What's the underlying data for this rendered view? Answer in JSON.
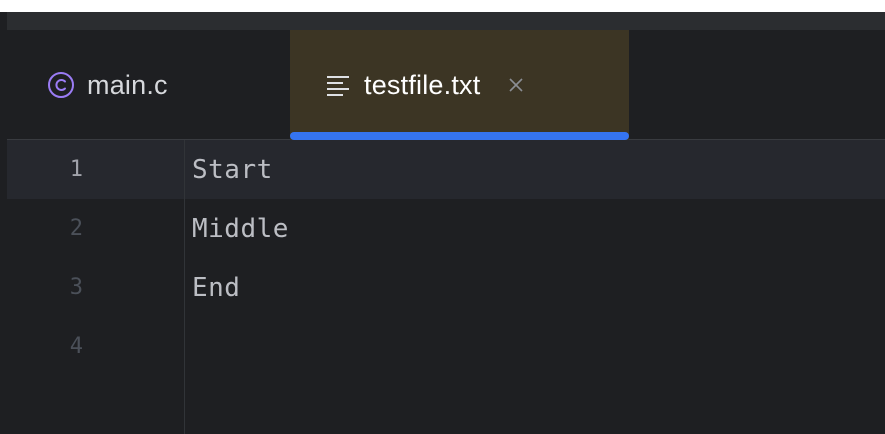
{
  "tabs": [
    {
      "label": "main.c",
      "icon": "c-file-icon",
      "active": false
    },
    {
      "label": "testfile.txt",
      "icon": "text-file-icon",
      "active": true,
      "closable": true
    }
  ],
  "editor": {
    "lines": [
      {
        "number": "1",
        "text": "Start"
      },
      {
        "number": "2",
        "text": "Middle"
      },
      {
        "number": "3",
        "text": "End"
      },
      {
        "number": "4",
        "text": ""
      }
    ]
  },
  "colors": {
    "background": "#1e1f22",
    "active_tab": "#3c3524",
    "active_tab_indicator": "#3574f0",
    "current_line": "#26282e",
    "c_icon": "#9b7cf5"
  }
}
